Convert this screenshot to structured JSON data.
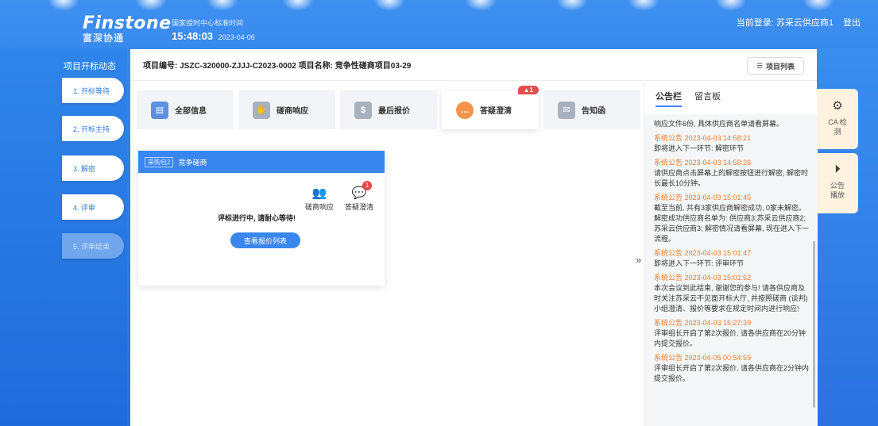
{
  "header": {
    "logo_main": "Finstone",
    "logo_sub": "富深协通",
    "clock_label": "国家授时中心标准时间",
    "time": "15:48:03",
    "date": "2023-04-06",
    "login_text": "当前登录: 苏采云供应商1",
    "logout": "登出"
  },
  "steps": {
    "title": "项目开标动态",
    "items": [
      "1. 开标等待",
      "2. 开标主持",
      "3. 解密",
      "4. 评审",
      "5. 评审结束"
    ]
  },
  "project": {
    "header": "项目编号: JSZC-320000-ZJJJ-C2023-0002 项目名称: 竞争性磋商项目03-29",
    "list_button": "项目列表"
  },
  "tabs": [
    {
      "label": "全部信息",
      "icon": "info-icon",
      "color": "#5b8fe0"
    },
    {
      "label": "磋商响应",
      "icon": "hands-icon",
      "color": "#a9b1bf"
    },
    {
      "label": "最后报价",
      "icon": "money-bag-icon",
      "color": "#a9b1bf"
    },
    {
      "label": "答疑澄清",
      "icon": "chat-icon",
      "color": "#f5944a",
      "badge": "▲1"
    },
    {
      "label": "告知函",
      "icon": "notice-icon",
      "color": "#a9b1bf"
    }
  ],
  "package": {
    "tag": "采购包2",
    "name": "竞争磋商",
    "icon1_label": "磋商响应",
    "icon2_label": "答疑澄清",
    "icon2_count": "1",
    "status": "评标进行中, 请耐心等待!",
    "button": "查看报价列表"
  },
  "bulletin": {
    "tab_active": "公告栏",
    "tab_other": "留言板",
    "items": [
      {
        "time": "",
        "text": "响应文件6份, 具体供应商名单请看屏幕。"
      },
      {
        "time": "系统公告 2023-04-03 14:58:21",
        "text": "即将进入下一环节: 解密环节"
      },
      {
        "time": "系统公告 2023-04-03 14:58:26",
        "text": "请供应商点击屏幕上的解密按钮进行解密, 解密时长最长10分钟。"
      },
      {
        "time": "系统公告 2023-04-03 15:01:45",
        "text": "截至当前, 共有3家供应商解密成功, 0家未解密。解密成功供应商名单为: 供应商3;苏采云供应商2;苏采云供应商3; 解密情况请看屏幕, 现在进入下一流程。"
      },
      {
        "time": "系统公告 2023-04-03 15:01:47",
        "text": "即将进入下一环节: 评审环节"
      },
      {
        "time": "系统公告 2023-04-03 15:01:52",
        "text": "本次会议到此结束, 谢谢您的参与! 请各供应商及时关注苏采云不见面开标大厅, 并按照磋商 (谈判) 小组澄清、报价等要求在规定时间内进行响应!"
      },
      {
        "time": "系统公告 2023-04-03 15:27:39",
        "text": "评审组长开启了第2次报价, 请各供应商在20分钟内提交报价。"
      },
      {
        "time": "系统公告 2023-04-05 00:54:59",
        "text": "评审组长开启了第2次报价, 请各供应商在2分钟内提交报价。"
      }
    ]
  },
  "side": {
    "ca": "CA 检测",
    "play": "公告 播放"
  }
}
